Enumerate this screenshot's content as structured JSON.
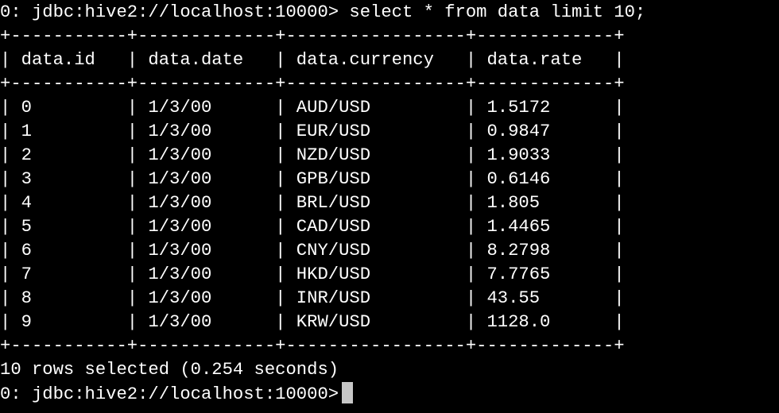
{
  "terminal": {
    "prompt": "0: jdbc:hive2://localhost:10000>",
    "command": "select * from data limit 10;",
    "border": "+-----------+-------------+-----------------+-------------+",
    "header": "| data.id   | data.date   | data.currency   | data.rate   |",
    "rows": [
      "| 0         | 1/3/00      | AUD/USD         | 1.5172      |",
      "| 1         | 1/3/00      | EUR/USD         | 0.9847      |",
      "| 2         | 1/3/00      | NZD/USD         | 1.9033      |",
      "| 3         | 1/3/00      | GPB/USD         | 0.6146      |",
      "| 4         | 1/3/00      | BRL/USD         | 1.805       |",
      "| 5         | 1/3/00      | CAD/USD         | 1.4465      |",
      "| 6         | 1/3/00      | CNY/USD         | 8.2798      |",
      "| 7         | 1/3/00      | HKD/USD         | 7.7765      |",
      "| 8         | 1/3/00      | INR/USD         | 43.55       |",
      "| 9         | 1/3/00      | KRW/USD         | 1128.0      |"
    ],
    "summary": "10 rows selected (0.254 seconds)",
    "colors": {
      "background": "#000000",
      "text": "#ffffff",
      "cursor": "#c7c7c7"
    }
  }
}
